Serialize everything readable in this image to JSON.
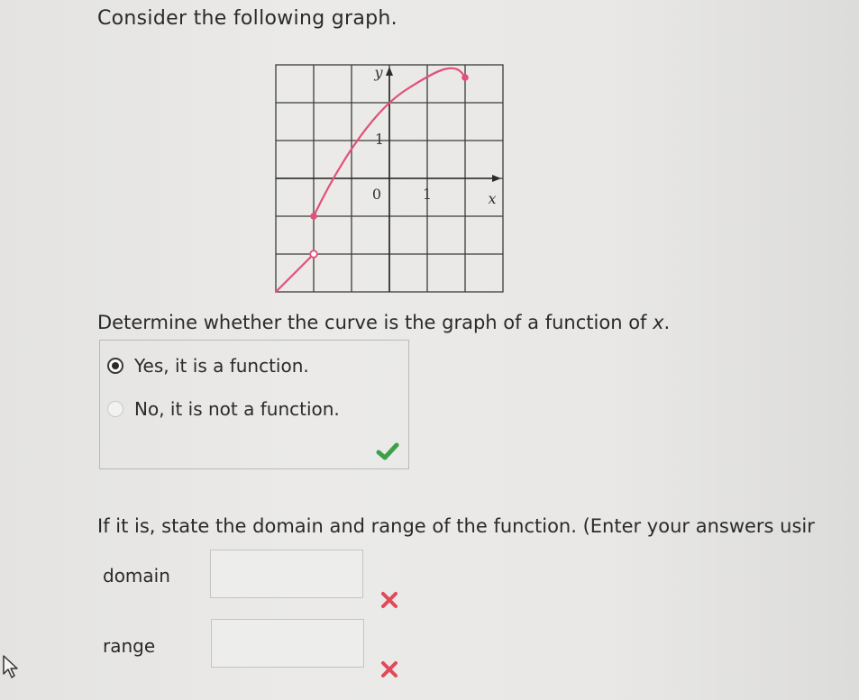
{
  "problem": {
    "intro": "Consider the following graph.",
    "question_before": "Determine whether the curve is the graph of a function of ",
    "question_var": "x",
    "question_after": ".",
    "choices": [
      {
        "label": "Yes, it is a function.",
        "selected": true
      },
      {
        "label": "No, it is not a function.",
        "selected": false
      }
    ],
    "choice_feedback_icon": "checkmark-icon",
    "domain_prompt": "If it is, state the domain and range of the function. (Enter your answers usir",
    "domain_label": "domain",
    "domain_value": "",
    "range_label": "range",
    "range_value": "",
    "answer_feedback_icon": "x-mark-icon"
  },
  "graph": {
    "y_axis_label": "y",
    "x_axis_label": "x",
    "tick_y_1": "1",
    "tick_origin": "0",
    "tick_x_1": "1",
    "curve_color": "#e2507a",
    "check_color": "#3fa04a",
    "error_color": "#e04a5a"
  },
  "cursor_icon": "mouse-pointer-icon"
}
